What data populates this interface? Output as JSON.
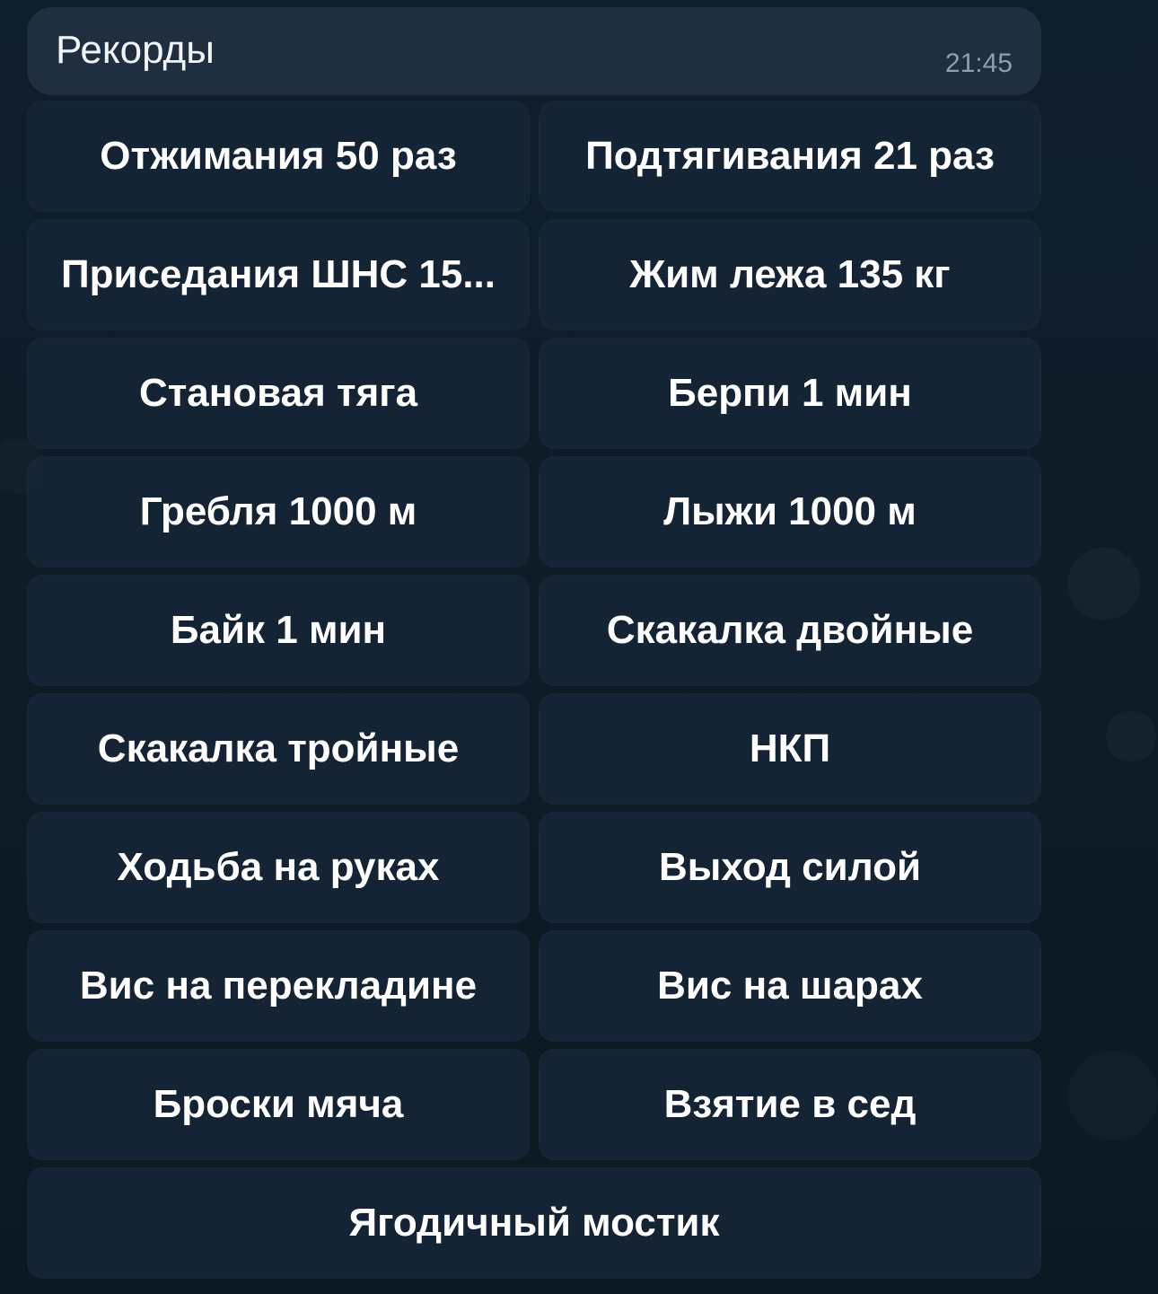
{
  "message": {
    "title": "Рекорды",
    "time": "21:45"
  },
  "keyboard": {
    "rows": [
      [
        "Отжимания 50 раз",
        "Подтягивания 21 раз"
      ],
      [
        "Приседания ШНС 15...",
        "Жим лежа 135 кг"
      ],
      [
        "Становая тяга",
        "Берпи 1 мин"
      ],
      [
        "Гребля 1000 м",
        "Лыжи 1000 м"
      ],
      [
        "Байк 1 мин",
        "Скакалка двойные"
      ],
      [
        "Скакалка тройные",
        "НКП"
      ],
      [
        "Ходьба на руках",
        "Выход силой"
      ],
      [
        "Вис на перекладине",
        "Вис на шарах"
      ],
      [
        "Броски мяча",
        "Взятие в сед"
      ],
      [
        "Ягодичный мостик"
      ]
    ]
  }
}
